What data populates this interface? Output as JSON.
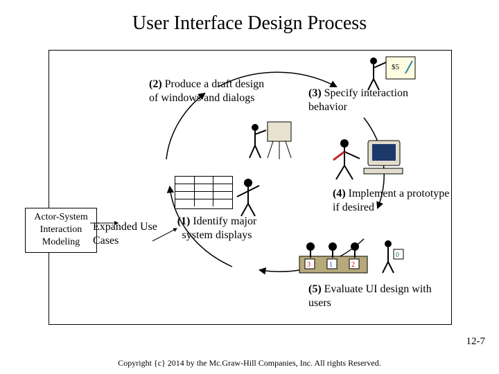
{
  "title": "User Interface Design Process",
  "steps": {
    "s1": {
      "num": "(1)",
      "text": "Identify major system displays"
    },
    "s2": {
      "num": "(2)",
      "text": "Produce a draft design of windows and dialogs"
    },
    "s3": {
      "num": "(3)",
      "text": "Specify interaction behavior"
    },
    "s4": {
      "num": "(4)",
      "text": "Implement a prototype if desired"
    },
    "s5": {
      "num": "(5)",
      "text": "Evaluate UI design with users"
    }
  },
  "inputs": {
    "box": "Actor-System Interaction Modeling",
    "label": "Expanded Use Cases"
  },
  "page": "12-7",
  "copyright": "Copyright {c} 2014 by the Mc.Graw-Hill Companies, Inc. All rights Reserved."
}
